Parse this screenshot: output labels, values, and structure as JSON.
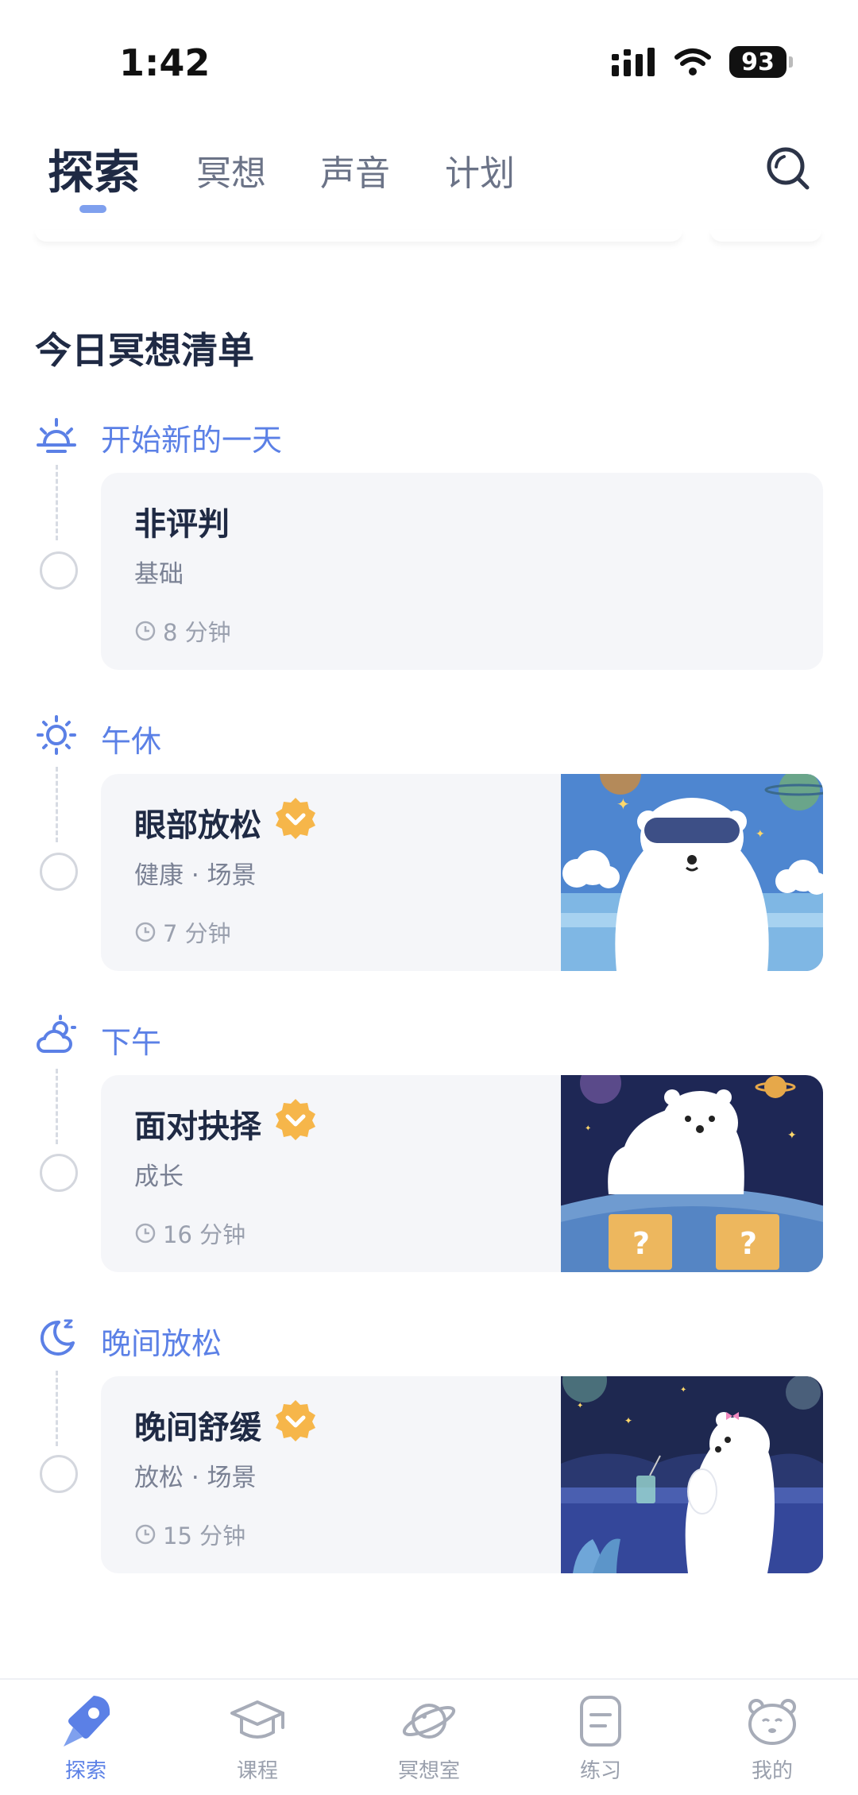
{
  "status_bar": {
    "time": "1:42",
    "battery": "93"
  },
  "top_tabs": {
    "explore": "探索",
    "meditation": "冥想",
    "sound": "声音",
    "plan": "计划"
  },
  "section_title": "今日冥想清单",
  "slots": [
    {
      "label": "开始新的一天",
      "icon": "sunrise-icon",
      "title": "非评判",
      "subtitle": "基础",
      "duration": "8 分钟",
      "badge": false
    },
    {
      "label": "午休",
      "icon": "sun-icon",
      "title": "眼部放松",
      "subtitle": "健康 · 场景",
      "duration": "7 分钟",
      "badge": true
    },
    {
      "label": "下午",
      "icon": "cloud-sun-icon",
      "title": "面对抉择",
      "subtitle": "成长",
      "duration": "16 分钟",
      "badge": true
    },
    {
      "label": "晚间放松",
      "icon": "moon-icon",
      "title": "晚间舒缓",
      "subtitle": "放松 · 场景",
      "duration": "15 分钟",
      "badge": true
    }
  ],
  "bottom_nav": {
    "explore": "探索",
    "course": "课程",
    "room": "冥想室",
    "practice": "练习",
    "mine": "我的"
  },
  "colors": {
    "accent": "#5b80e6",
    "badge": "#f6b64a",
    "card_bg": "#f5f6f9"
  }
}
